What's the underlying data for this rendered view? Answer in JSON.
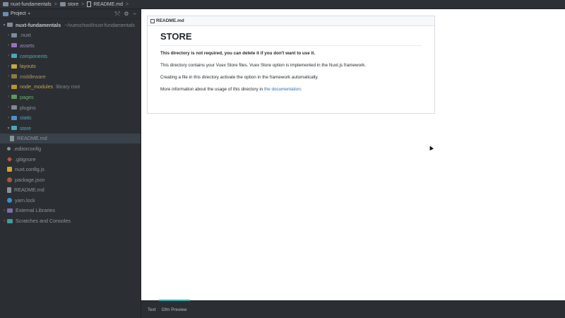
{
  "breadcrumb": [
    "nuxt-fundamentals",
    "store",
    "README.md"
  ],
  "sidebar": {
    "header": "Project",
    "items": [
      {
        "label": "nuxt-fundamentals",
        "suffix": "~/vueschool/nuxt-fundamentals",
        "icon": "folder-icon"
      },
      {
        "label": ".nuxt",
        "icon": "folder-icon"
      },
      {
        "label": "assets",
        "icon": "folder-icon"
      },
      {
        "label": "components",
        "icon": "folder-icon"
      },
      {
        "label": "layouts",
        "icon": "folder-icon"
      },
      {
        "label": "middleware",
        "icon": "folder-icon"
      },
      {
        "label": "node_modules",
        "suffix": "library root",
        "icon": "folder-icon"
      },
      {
        "label": "pages",
        "icon": "folder-icon"
      },
      {
        "label": "plugins",
        "icon": "folder-icon"
      },
      {
        "label": "static",
        "icon": "folder-icon"
      },
      {
        "label": "store",
        "icon": "folder-icon"
      },
      {
        "label": "README.md",
        "icon": "markdown-file-icon"
      },
      {
        "label": ".editorconfig",
        "icon": "config-file-icon"
      },
      {
        "label": ".gitignore",
        "icon": "git-file-icon"
      },
      {
        "label": "nuxt.config.js",
        "icon": "js-file-icon"
      },
      {
        "label": "package.json",
        "icon": "npm-file-icon"
      },
      {
        "label": "README.md",
        "icon": "markdown-file-icon"
      },
      {
        "label": "yarn.lock",
        "icon": "yarn-file-icon"
      },
      {
        "label": "External Libraries",
        "icon": "library-icon"
      },
      {
        "label": "Scratches and Consoles",
        "icon": "scratches-icon"
      }
    ]
  },
  "preview": {
    "filename": "README.md",
    "heading": "STORE",
    "bold_note": "This directory is not required, you can delete it if you don't want to use it.",
    "para1": "This directory contains your Vuex Store files. Vuex Store option is implemented in the Nuxt.js framework.",
    "para2": "Creating a file in this directory activate the option in the framework automatically.",
    "para3_prefix": "More information about the usage of this directory in",
    "para3_link": "the documentation",
    "para3_suffix": "."
  },
  "bottom_tabs": [
    "Text",
    "Gfm Preview"
  ]
}
